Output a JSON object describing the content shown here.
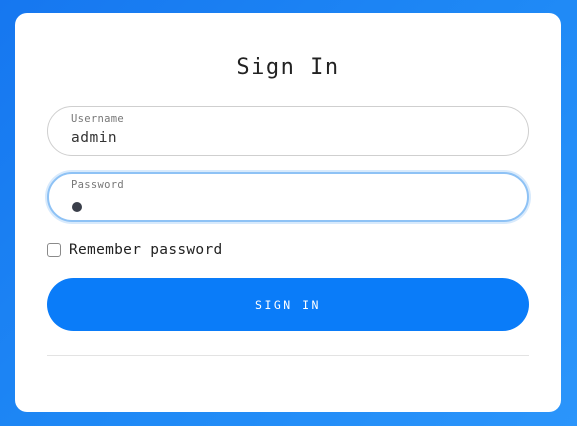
{
  "form": {
    "title": "Sign In",
    "username": {
      "label": "Username",
      "value": "admin"
    },
    "password": {
      "label": "Password",
      "masked_char_count": 1
    },
    "remember": {
      "label": "Remember password",
      "checked": false
    },
    "submit_label": "SIGN IN"
  },
  "colors": {
    "background": "#1e88f5",
    "button": "#0a7cf9",
    "focus_border": "#8ec2f5"
  }
}
